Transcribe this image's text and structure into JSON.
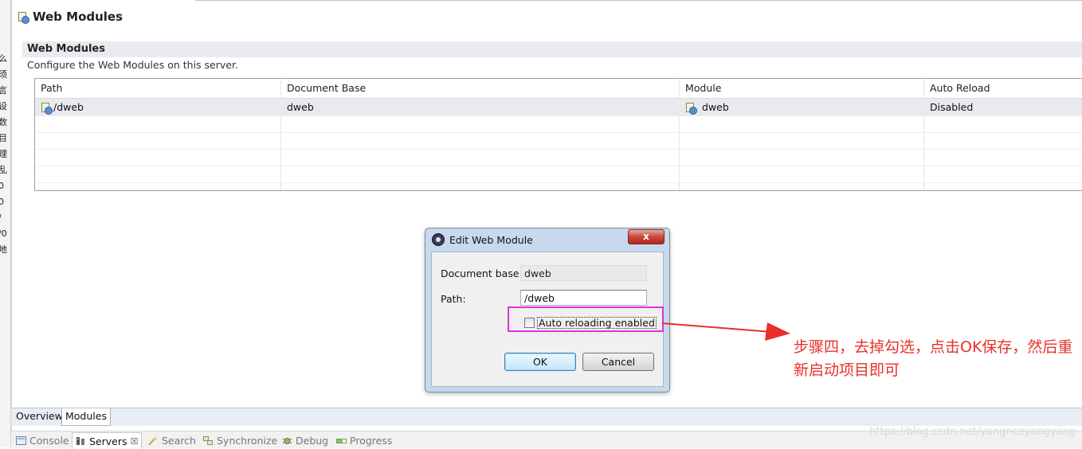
{
  "left_strip": [
    "么",
    "须",
    "言",
    "设",
    "数",
    "目",
    "理",
    "乱",
    "0",
    "0",
    "/",
    "/0",
    "地"
  ],
  "editor": {
    "title": "Web Modules",
    "section_title": "Web Modules",
    "section_desc": "Configure the Web Modules on this server.",
    "columns": [
      "Path",
      "Document Base",
      "Module",
      "Auto Reload"
    ],
    "rows": [
      {
        "path": "/dweb",
        "document_base": "dweb",
        "module": "dweb",
        "auto_reload": "Disabled"
      }
    ],
    "tabs": [
      "Overview",
      "Modules"
    ],
    "selected_tab": "Modules"
  },
  "views": {
    "tabs": [
      "Console",
      "Servers",
      "Search",
      "Synchronize",
      "Debug",
      "Progress"
    ],
    "selected": "Servers",
    "close_glyph": "☒"
  },
  "dialog": {
    "title": "Edit Web Module",
    "close_glyph": "x",
    "document_base_label": "Document base:",
    "document_base_value": "dweb",
    "path_label": "Path:",
    "path_value": "/dweb",
    "auto_reload_label": "Auto reloading enabled",
    "auto_reload_checked": false,
    "ok_label": "OK",
    "cancel_label": "Cancel"
  },
  "annotation": {
    "text": "步骤四，去掉勾选，点击OK保存，然后重新启动项目即可",
    "color": "#e8302b",
    "highlight_color": "#e02fe0"
  },
  "watermark": "https://blog.csdn.net/yangnceyangyang"
}
